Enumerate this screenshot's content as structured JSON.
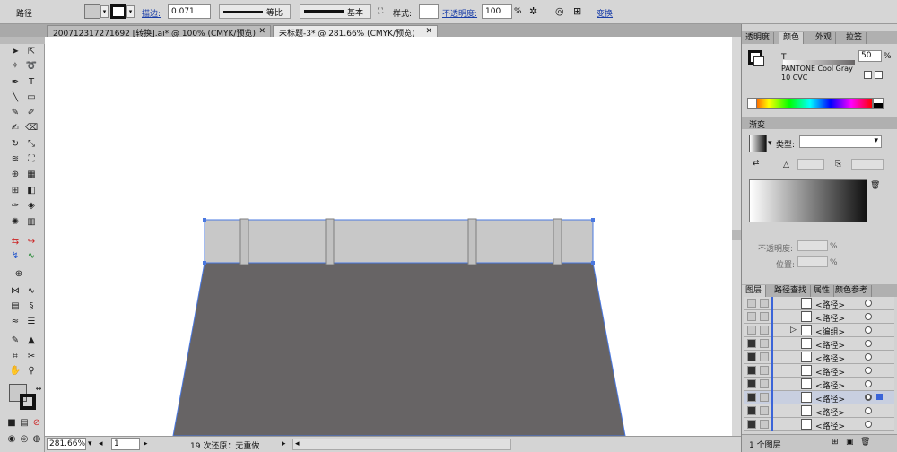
{
  "control_bar": {
    "path_label": "路径",
    "stroke_label": "描边:",
    "stroke_weight": "0.071",
    "profile_label": "等比",
    "brush_label": "基本",
    "style_label": "样式:",
    "opacity_label": "不透明度:",
    "opacity_value": "100",
    "opacity_unit": "%",
    "transform_label": "变换",
    "fill_color": "#c9c9c9"
  },
  "doc_tabs": [
    {
      "label": "200712317271692 [转换].ai* @ 100% (CMYK/预览)",
      "close": "✕"
    },
    {
      "label": "未标题-3* @ 281.66% (CMYK/预览)",
      "close": "✕"
    }
  ],
  "canvas": {
    "top_fill": "#c8c8c8",
    "body_fill": "#676465",
    "selection_color": "#4a78e0"
  },
  "status_bar": {
    "zoom": "281.66%",
    "page": "1",
    "undo_text": "19 次还原：无重做"
  },
  "color_panel": {
    "tabs": [
      "透明度",
      "颜色",
      "外观",
      "拉签"
    ],
    "tint_label": "T",
    "tint_value": "50",
    "tint_unit": "%",
    "swatch_name": "PANTONE Cool Gray 10 CVC"
  },
  "gradient_panel": {
    "title": "渐变",
    "type_label": "类型:",
    "opacity_label": "不透明度:",
    "opacity_unit": "%",
    "position_label": "位置:",
    "position_unit": "%"
  },
  "layers_panel": {
    "tabs": [
      "图层",
      "路径查找",
      "属性",
      "颜色参考"
    ],
    "rows": [
      {
        "name": "<路径>"
      },
      {
        "name": "<路径>"
      },
      {
        "name": "<编组>"
      },
      {
        "name": "<路径>"
      },
      {
        "name": "<路径>"
      },
      {
        "name": "<路径>"
      },
      {
        "name": "<路径>"
      },
      {
        "name": "<路径>"
      },
      {
        "name": "<路径>"
      },
      {
        "name": "<路径>"
      }
    ],
    "footer": "1 个图层"
  }
}
